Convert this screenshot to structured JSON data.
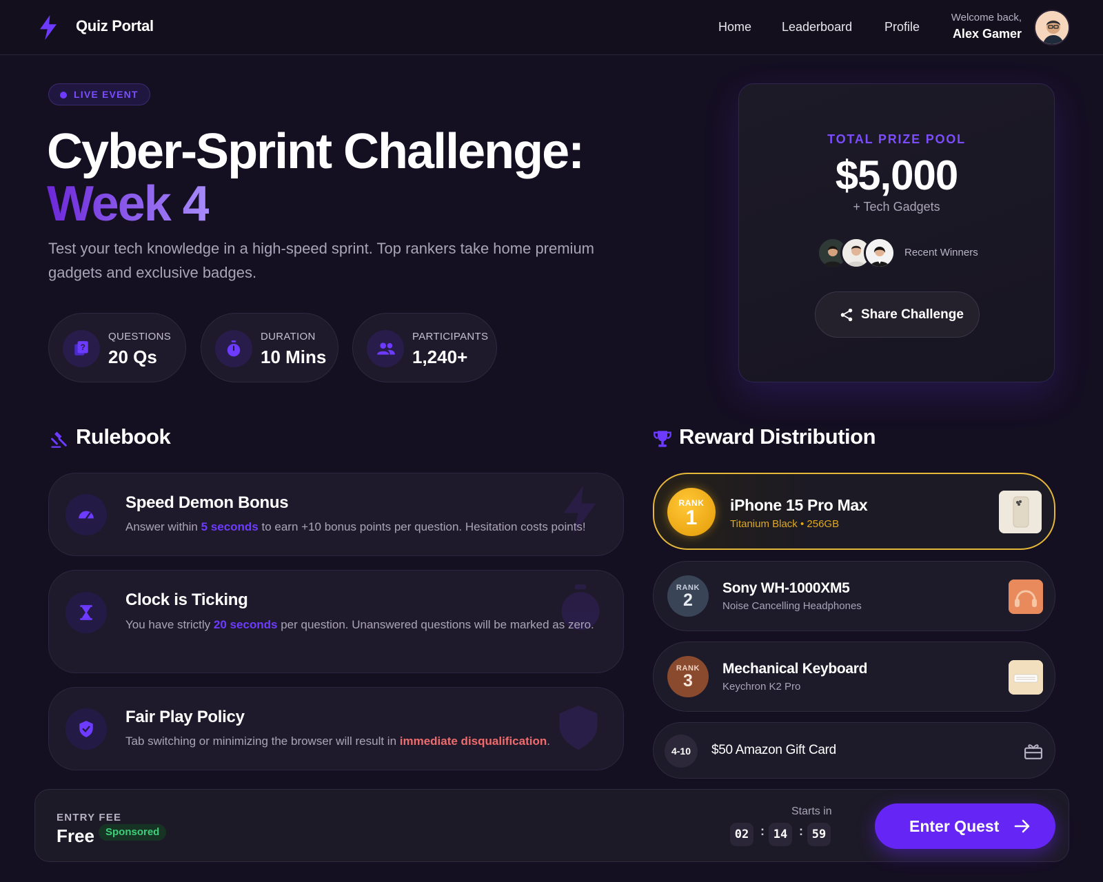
{
  "header": {
    "brand": "Quiz Portal",
    "nav": [
      "Home",
      "Leaderboard",
      "Profile"
    ],
    "welcome_small": "Welcome back,",
    "user_name": "Alex Gamer"
  },
  "hero": {
    "badge": "LIVE EVENT",
    "title": "Cyber-Sprint Challenge:",
    "title_accent": "Week 4",
    "description": "Test your tech knowledge in a high-speed sprint. Top rankers take home premium gadgets and exclusive badges.",
    "stats": [
      {
        "label": "QUESTIONS",
        "value": "20 Qs",
        "icon": "quiz-icon"
      },
      {
        "label": "DURATION",
        "value": "10 Mins",
        "icon": "stopwatch-icon"
      },
      {
        "label": "PARTICIPANTS",
        "value": "1,240+",
        "icon": "people-icon"
      }
    ]
  },
  "prize": {
    "label": "TOTAL PRIZE POOL",
    "amount": "$5,000",
    "extra": "+ Tech Gadgets",
    "winners_label": "Recent Winners",
    "share_label": "Share Challenge"
  },
  "rulebook": {
    "title": "Rulebook",
    "rules": [
      {
        "title": "Speed Demon Bonus",
        "pre": "Answer within ",
        "highlight": "5 seconds",
        "post": " to earn +10 bonus points per question. Hesitation costs points!",
        "icon": "speedometer-icon"
      },
      {
        "title": "Clock is Ticking",
        "pre": "You have strictly ",
        "highlight": "20 seconds",
        "post": " per question. Unanswered questions will be marked as zero.",
        "icon": "hourglass-icon"
      },
      {
        "title": "Fair Play Policy",
        "pre": "Tab switching or minimizing the browser will result in ",
        "highlight": "immediate disqualification",
        "post": ".",
        "icon": "shield-icon"
      }
    ]
  },
  "rewards": {
    "title": "Reward Distribution",
    "items": [
      {
        "rank_label": "RANK",
        "rank": "1",
        "name": "iPhone 15 Pro Max",
        "sub": "Titanium Black • 256GB"
      },
      {
        "rank_label": "RANK",
        "rank": "2",
        "name": "Sony WH-1000XM5",
        "sub": "Noise Cancelling Headphones"
      },
      {
        "rank_label": "RANK",
        "rank": "3",
        "name": "Mechanical Keyboard",
        "sub": "Keychron K2 Pro"
      }
    ],
    "extra": {
      "range": "4-10",
      "name": "$50 Amazon Gift Card"
    }
  },
  "footer": {
    "fee_label": "ENTRY FEE",
    "fee_value": "Free",
    "sponsor": "Sponsored",
    "starts_label": "Starts in",
    "countdown": [
      "02",
      "14",
      "59"
    ],
    "enter_label": "Enter Quest"
  },
  "colors": {
    "accent": "#6d3bff",
    "background": "#150f22",
    "gold": "#e6b83a",
    "danger": "#f06b6b",
    "success": "#3ecf7a"
  }
}
